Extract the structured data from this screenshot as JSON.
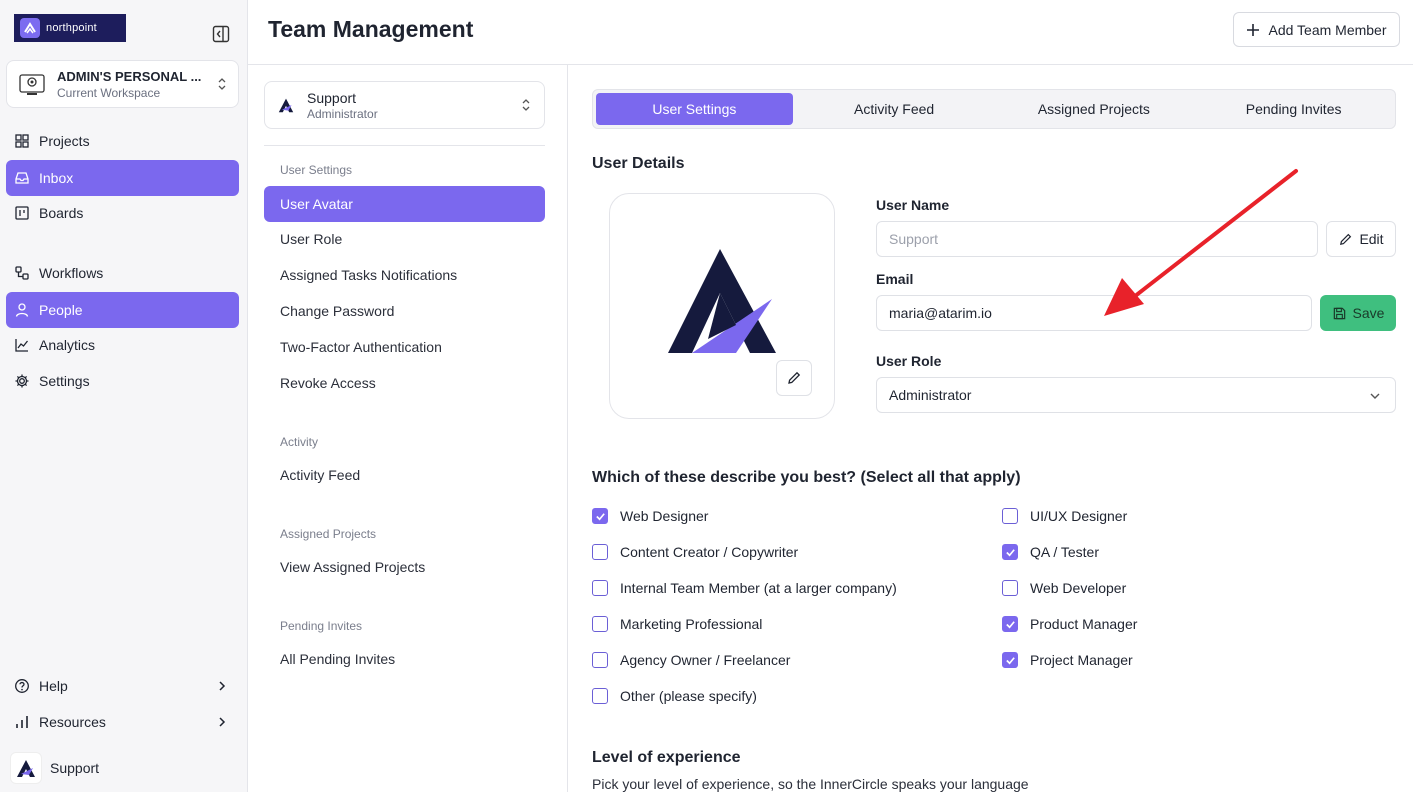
{
  "brand": {
    "name": "northpoint"
  },
  "workspace": {
    "title": "ADMIN'S PERSONAL ...",
    "subtitle": "Current Workspace"
  },
  "nav": {
    "projects": "Projects",
    "inbox": "Inbox",
    "boards": "Boards",
    "workflows": "Workflows",
    "people": "People",
    "analytics": "Analytics",
    "settings": "Settings",
    "help": "Help",
    "resources": "Resources"
  },
  "current_user": {
    "name": "Support"
  },
  "header": {
    "title": "Team Management",
    "add_button": "Add Team Member"
  },
  "user_select": {
    "name": "Support",
    "role": "Administrator"
  },
  "settings_menu": {
    "user_settings_head": "User Settings",
    "user_avatar": "User Avatar",
    "user_role": "User Role",
    "assigned_tasks": "Assigned Tasks Notifications",
    "change_password": "Change Password",
    "two_factor": "Two-Factor Authentication",
    "revoke": "Revoke Access",
    "activity_head": "Activity",
    "activity_feed": "Activity Feed",
    "assigned_projects_head": "Assigned Projects",
    "view_projects": "View Assigned Projects",
    "pending_head": "Pending Invites",
    "all_pending": "All Pending Invites"
  },
  "tabs": [
    "User Settings",
    "Activity Feed",
    "Assigned Projects",
    "Pending Invites"
  ],
  "details": {
    "heading": "User Details",
    "username_label": "User Name",
    "username_placeholder": "Support",
    "edit_label": "Edit",
    "email_label": "Email",
    "email_value": "maria@atarim.io",
    "save_label": "Save",
    "role_label": "User Role",
    "role_value": "Administrator"
  },
  "question": {
    "heading": "Which of these describe you best? (Select all that apply)",
    "left": [
      {
        "label": "Web Designer",
        "checked": true
      },
      {
        "label": "Content Creator / Copywriter",
        "checked": false
      },
      {
        "label": "Internal Team Member (at a larger company)",
        "checked": false
      },
      {
        "label": "Marketing Professional",
        "checked": false
      },
      {
        "label": "Agency Owner / Freelancer",
        "checked": false
      },
      {
        "label": "Other (please specify)",
        "checked": false
      }
    ],
    "right": [
      {
        "label": "UI/UX Designer",
        "checked": false
      },
      {
        "label": "QA / Tester",
        "checked": true
      },
      {
        "label": "Web Developer",
        "checked": false
      },
      {
        "label": "Product Manager",
        "checked": true
      },
      {
        "label": "Project Manager",
        "checked": true
      }
    ]
  },
  "experience": {
    "heading": "Level of experience",
    "subtitle": "Pick your level of experience, so the InnerCircle speaks your language"
  },
  "colors": {
    "accent": "#7b68ee",
    "save": "#3fbf7f",
    "annotation_arrow": "#e8222a"
  }
}
